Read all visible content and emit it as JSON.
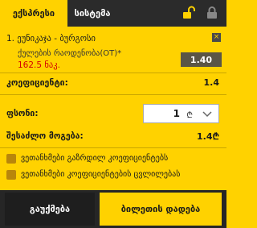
{
  "tabs": {
    "express": "ექსპრესი",
    "system": "სისტემა"
  },
  "icons": {
    "unlock": "unlock-icon",
    "lock": "lock-icon",
    "close": "close-icon",
    "chevron": "chevron-down-icon"
  },
  "selection": {
    "title": "1. ეუნიკაჯა - ბურგოსი",
    "market": "ქულების რაოდენობა(OT)*",
    "amount": "162.5 ნაკ.",
    "odds": "1.40",
    "close": "×"
  },
  "coefficient": {
    "label": "კოეფიციენტი:",
    "value": "1.4"
  },
  "stake": {
    "label": "ფსონი:",
    "value": "1",
    "currency": "₾"
  },
  "possible_win": {
    "label": "შესაძლო მოგება:",
    "value": "1.4₾"
  },
  "options": [
    {
      "label": "ვეთანხმები გაზრდილ კოეფიციენტებს"
    },
    {
      "label": "ვეთანხმები კოეფიციენტების ცვლილებას"
    }
  ],
  "buttons": {
    "cancel": "გაუქმება",
    "place": "ბილეთის დადება"
  },
  "colors": {
    "accent": "#ffd200",
    "dark": "#262626",
    "loss": "#d40000"
  }
}
